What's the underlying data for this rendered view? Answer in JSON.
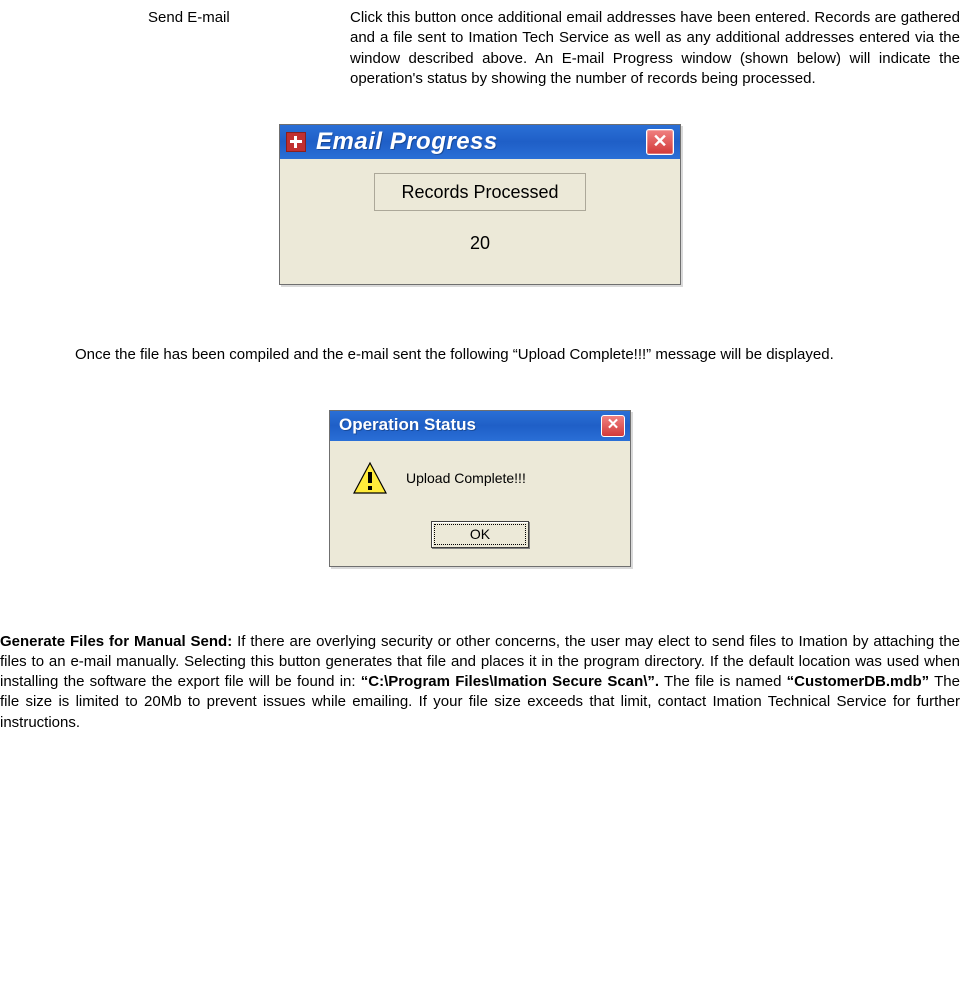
{
  "row1": {
    "label": "Send E-mail",
    "body": "Click this button once additional email addresses have been entered.  Records are gathered and a file sent to Imation Tech Service as well as any additional addresses entered via the window described above.  An E-mail Progress window (shown below) will indicate the operation's status by showing the number of records being processed."
  },
  "win1": {
    "title": "Email Progress",
    "close_glyph": "✕",
    "group_label": "Records Processed",
    "count": "20"
  },
  "para2": "Once the file has been compiled and the e-mail sent the following “Upload Complete!!!” message will be displayed.",
  "win2": {
    "title": "Operation Status",
    "close_glyph": "✕",
    "message": "Upload Complete!!!",
    "ok_label": "OK"
  },
  "para3": {
    "lead_bold": "Generate Files for Manual Send:",
    "t1": "  If there are overlying security or other concerns, the user may elect to send files to Imation by attaching the files to an e-mail manually.  Selecting this button generates that file and places it in the program directory.  If the default location was used when installing the software the export file will be found in:   ",
    "path_bold": "“C:\\Program  Files\\Imation  Secure  Scan\\”.",
    "t2": "   The  file  is  named ",
    "name_bold": "“CustomerDB.mdb”",
    "t3": " The file size is limited to 20Mb to prevent issues while emailing.  If your file size exceeds that limit, contact Imation Technical Service for further instructions."
  }
}
